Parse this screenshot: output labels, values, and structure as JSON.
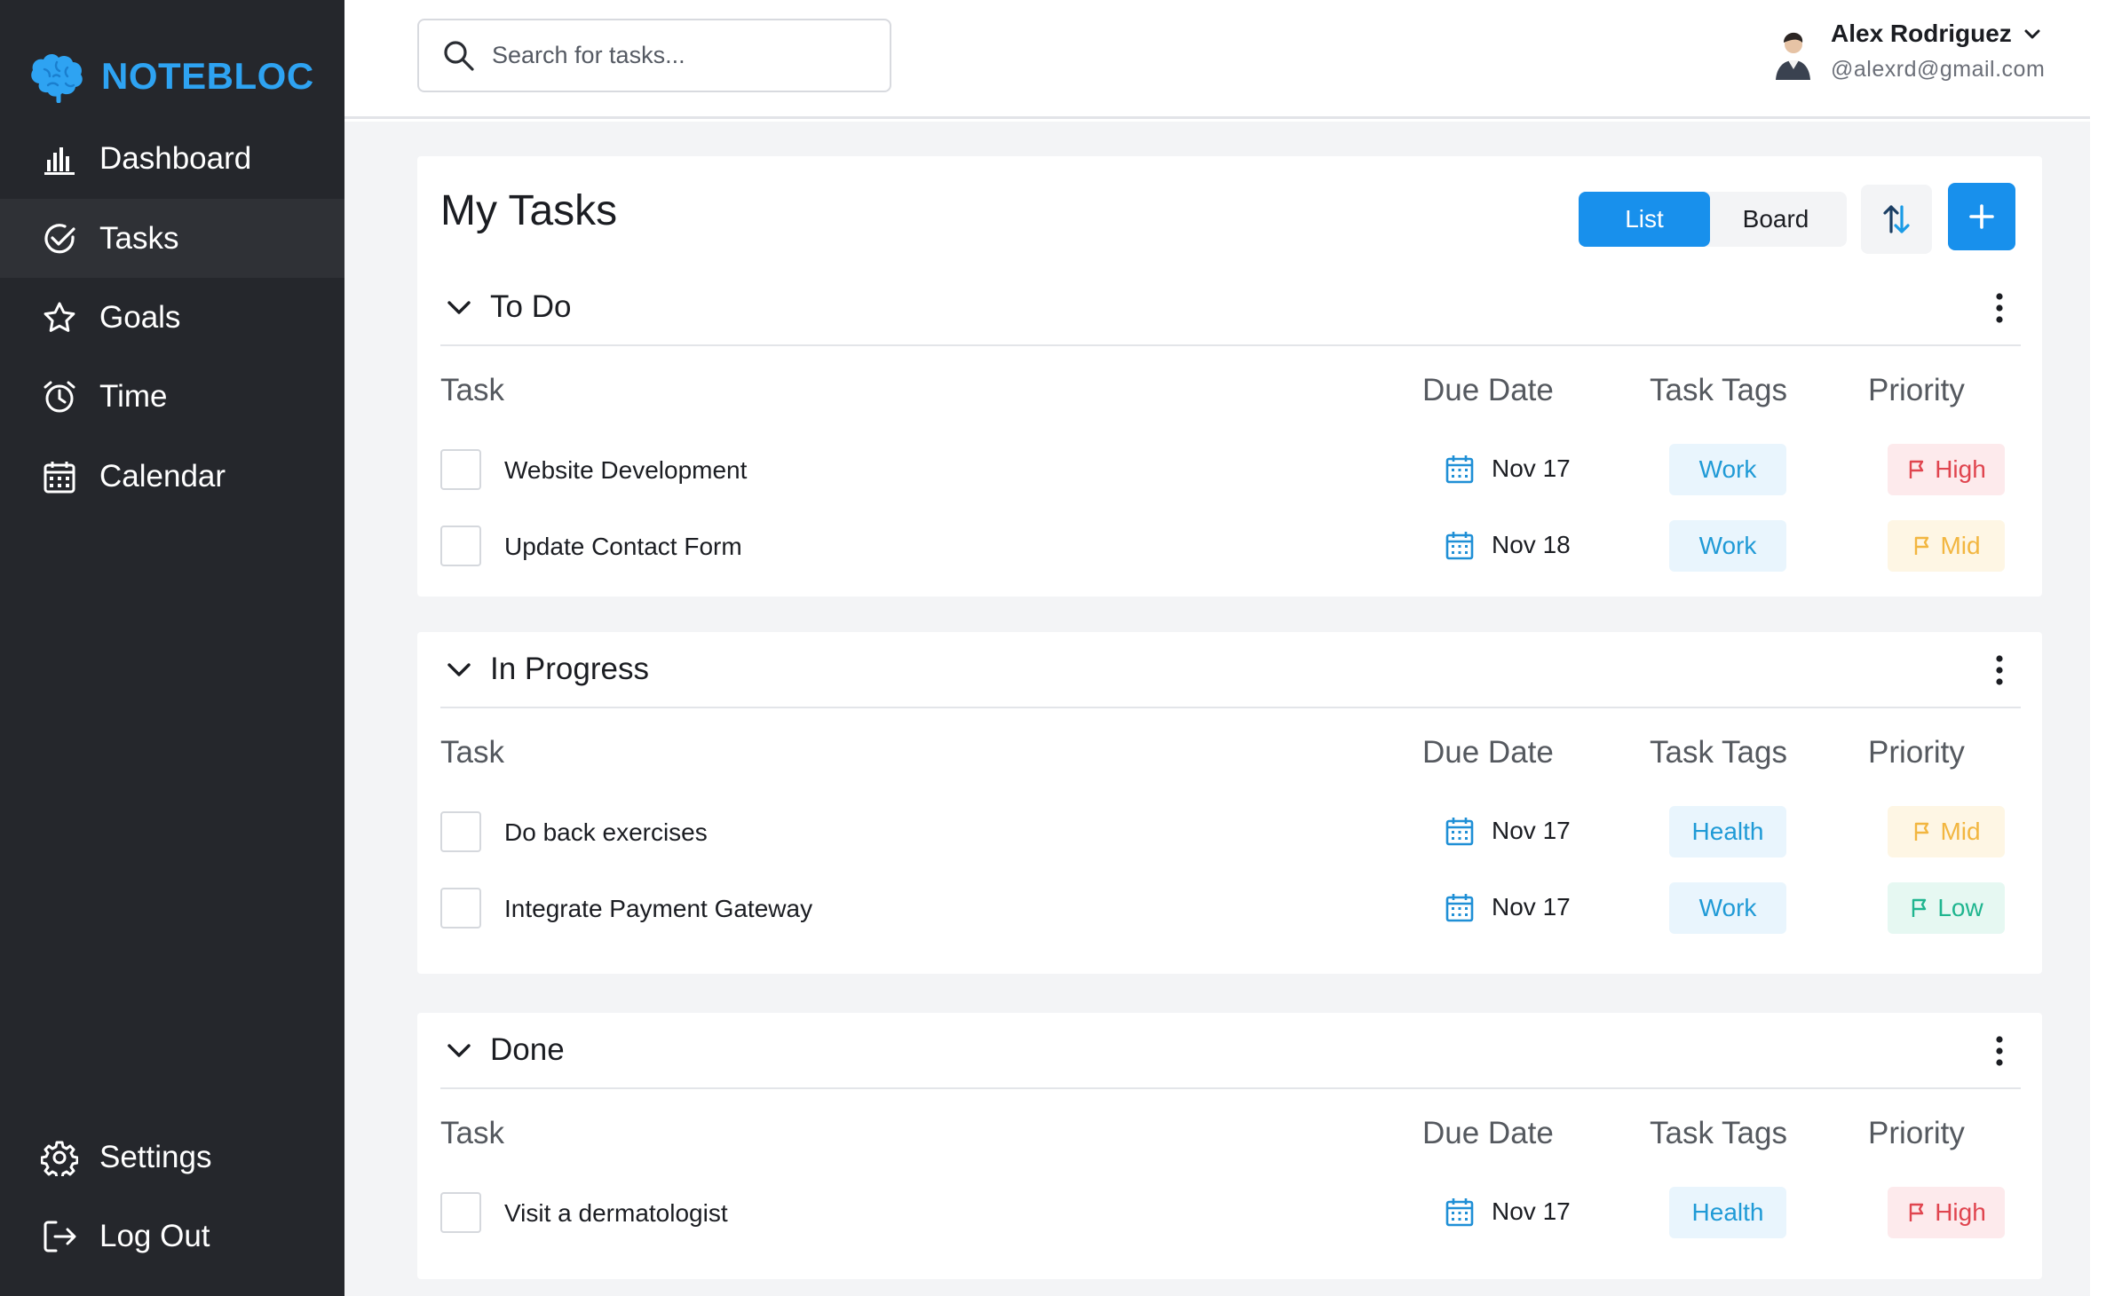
{
  "brand": {
    "name": "NOTEBLOC",
    "logo_icon": "brain-icon",
    "color": "#2ea3f2"
  },
  "sidebar": {
    "items": [
      {
        "label": "Dashboard",
        "icon": "bar-chart-icon"
      },
      {
        "label": "Tasks",
        "icon": "check-circle-icon",
        "active": true
      },
      {
        "label": "Goals",
        "icon": "star-icon"
      },
      {
        "label": "Time",
        "icon": "alarm-clock-icon"
      },
      {
        "label": "Calendar",
        "icon": "calendar-icon"
      }
    ],
    "bottom_items": [
      {
        "label": "Settings",
        "icon": "gear-icon"
      },
      {
        "label": "Log Out",
        "icon": "logout-icon"
      }
    ]
  },
  "header": {
    "search": {
      "placeholder": "Search for tasks...",
      "value": ""
    },
    "user": {
      "name": "Alex Rodriguez",
      "email": "@alexrd@gmail.com"
    }
  },
  "main": {
    "title": "My Tasks",
    "view_toggle": {
      "list": "List",
      "board": "Board",
      "selected": "List"
    },
    "columns": {
      "task": "Task",
      "due": "Due Date",
      "tags": "Task Tags",
      "priority": "Priority"
    },
    "groups": [
      {
        "title": "To Do",
        "tasks": [
          {
            "name": "Website Development",
            "due": "Nov 17",
            "tag": "Work",
            "priority": "High"
          },
          {
            "name": "Update Contact Form",
            "due": "Nov 18",
            "tag": "Work",
            "priority": "Mid"
          }
        ]
      },
      {
        "title": "In Progress",
        "tasks": [
          {
            "name": "Do back exercises",
            "due": "Nov 17",
            "tag": "Health",
            "priority": "Mid"
          },
          {
            "name": "Integrate Payment Gateway",
            "due": "Nov 17",
            "tag": "Work",
            "priority": "Low"
          }
        ]
      },
      {
        "title": "Done",
        "tasks": [
          {
            "name": "Visit a dermatologist",
            "due": "Nov 17",
            "tag": "Health",
            "priority": "High"
          }
        ]
      }
    ]
  },
  "colors": {
    "accent": "#1890ec",
    "sidebar_bg": "#25272c",
    "priority_high": "#e0454f",
    "priority_mid": "#f2b640",
    "priority_low": "#1fb58f"
  }
}
